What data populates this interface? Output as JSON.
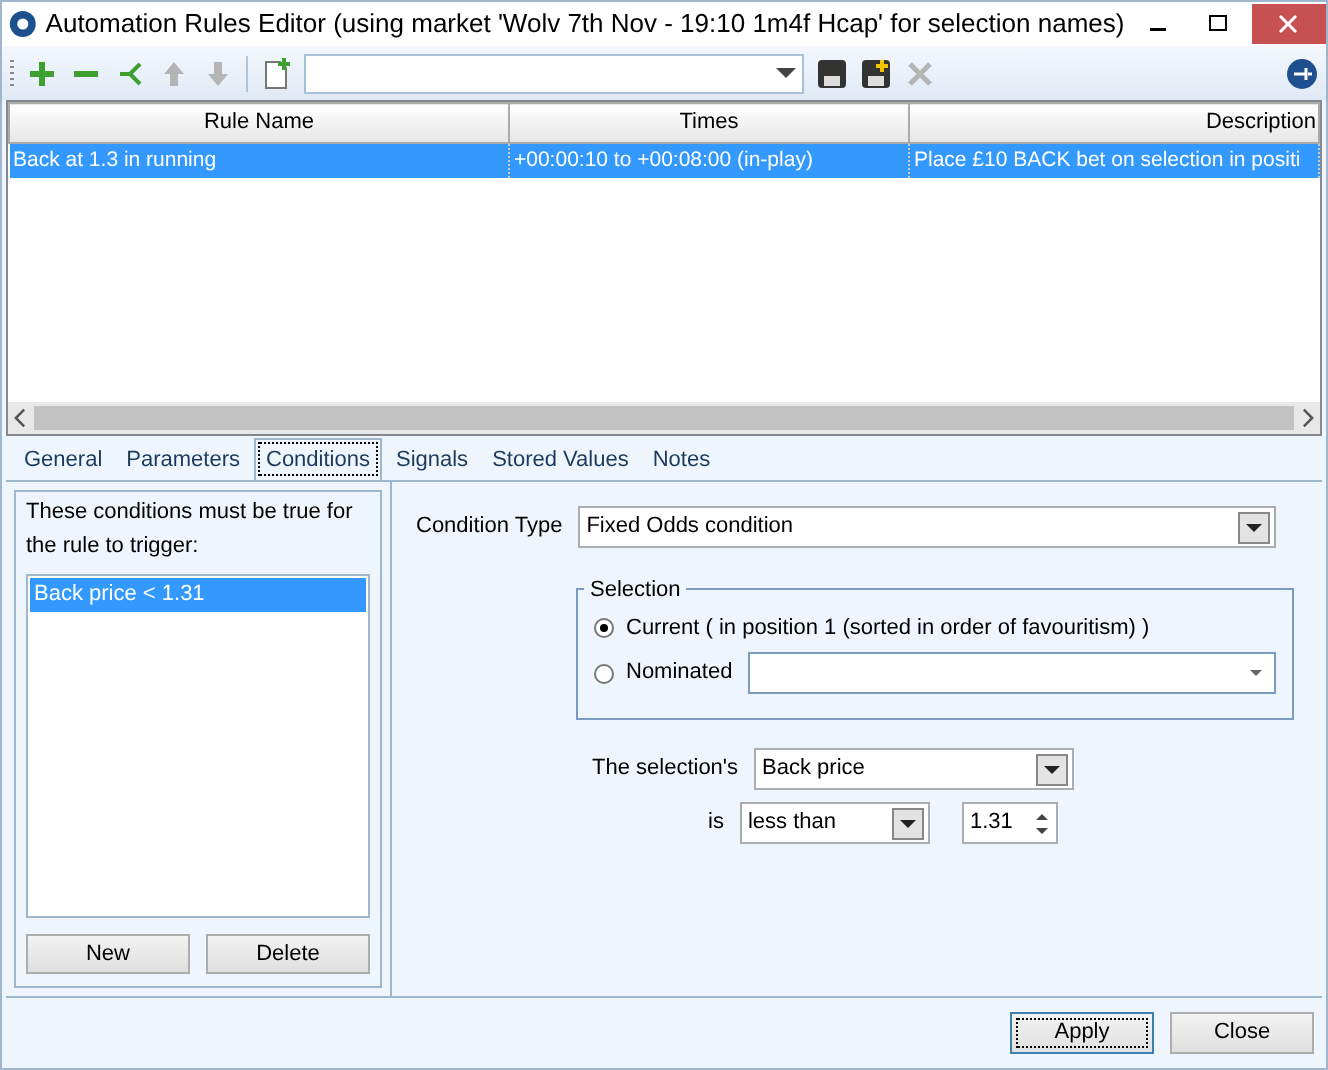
{
  "window": {
    "title": "Automation Rules Editor (using market 'Wolv 7th Nov - 19:10 1m4f Hcap' for selection names)"
  },
  "toolbar": {
    "buttons": [
      {
        "kind": "add",
        "disabled": false
      },
      {
        "kind": "remove",
        "disabled": false
      },
      {
        "kind": "branch",
        "disabled": false
      },
      {
        "kind": "up",
        "disabled": true
      },
      {
        "kind": "down",
        "disabled": true
      },
      {
        "kind": "sep",
        "disabled": false
      },
      {
        "kind": "new-file",
        "disabled": false
      },
      {
        "kind": "combo",
        "disabled": false
      },
      {
        "kind": "save",
        "disabled": false
      },
      {
        "kind": "save-new",
        "disabled": false
      },
      {
        "kind": "delete",
        "disabled": true
      }
    ]
  },
  "rules_grid": {
    "columns": [
      "Rule Name",
      "Times",
      "Description"
    ],
    "rows": [
      {
        "cells": [
          "Back at 1.3 in running",
          "+00:00:10 to +00:08:00 (in-play)",
          "Place £10 BACK bet on selection in positi"
        ],
        "selected": true
      }
    ]
  },
  "tabs": [
    {
      "label": "General",
      "selected": false
    },
    {
      "label": "Parameters",
      "selected": false
    },
    {
      "label": "Conditions",
      "selected": true
    },
    {
      "label": "Signals",
      "selected": false
    },
    {
      "label": "Stored Values",
      "selected": false
    },
    {
      "label": "Notes",
      "selected": false
    }
  ],
  "conditions": {
    "caption": "These conditions must be true for the rule to trigger:",
    "items": [
      {
        "label": "Back price < 1.31",
        "selected": true
      }
    ],
    "buttons": [
      "New",
      "Delete"
    ]
  },
  "condition_type": {
    "label": "Condition Type",
    "value": "Fixed Odds condition"
  },
  "selection": {
    "caption": "Selection",
    "options": [
      {
        "label": "Current ( in position 1 (sorted in order of favouritism) )",
        "selected": true
      },
      {
        "label": "Nominated",
        "selected": false
      }
    ]
  },
  "property": {
    "label": "The selection's",
    "value": "Back price"
  },
  "operator": {
    "label": "is",
    "value": "less than"
  },
  "threshold": {
    "value": "1.31"
  },
  "footer_buttons": [
    {
      "label": "Apply",
      "focused": true
    },
    {
      "label": "Close",
      "focused": false
    }
  ]
}
